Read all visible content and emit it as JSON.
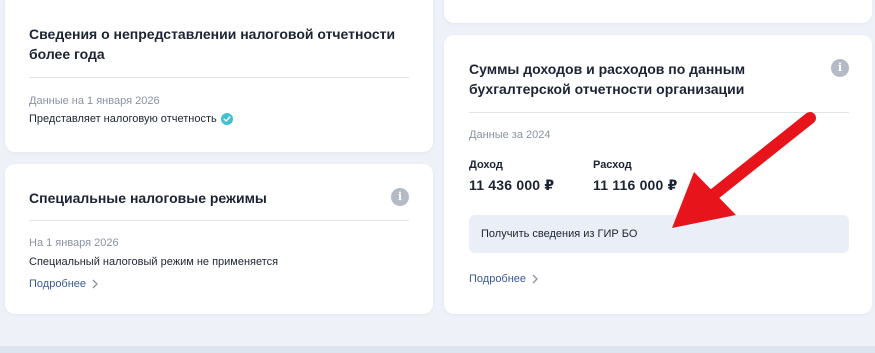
{
  "left_top_card": {
    "title": "Сведения о непредставлении налоговой отчетности более года",
    "date": "Данные на 1 января 2026",
    "status": "Представляет налоговую отчетность",
    "status_icon": "check-circle-icon"
  },
  "left_bottom_card": {
    "title": "Специальные налоговые режимы",
    "date": "На 1 января 2026",
    "status": "Специальный налоговый режим не применяется",
    "more_link": "Подробнее",
    "info_icon": "i"
  },
  "right_card": {
    "title": "Суммы доходов и расходов по данным бухгалтерской отчетности организации",
    "date": "Данные за 2024",
    "income_label": "Доход",
    "income_value": "11 436 000 ₽",
    "expense_label": "Расход",
    "expense_value": "11 116 000 ₽",
    "gir_button": "Получить сведения из ГИР БО",
    "more_link": "Подробнее",
    "info_icon": "i"
  },
  "colors": {
    "background": "#eef1f8",
    "card": "#ffffff",
    "link": "#3b5a9a",
    "arrow": "#e8141c",
    "check": "#3ec1d3"
  }
}
